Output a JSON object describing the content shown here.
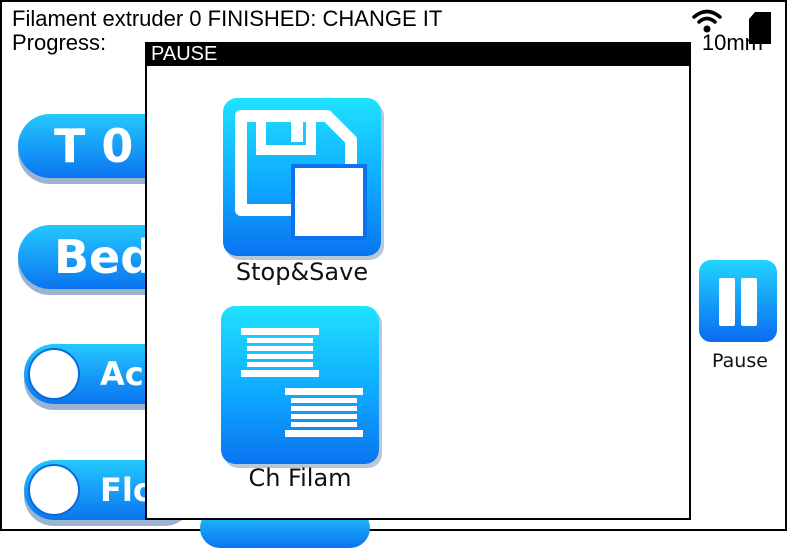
{
  "status": {
    "line1": "Filament extruder 0 FINISHED: CHANGE IT",
    "line2_label": "Progress:",
    "line2_right": "10mm",
    "wifi_icon": "wifi-icon",
    "sd_icon": "sd-card-icon"
  },
  "controls": {
    "temp_label": "T 0",
    "bed_label": "Bed",
    "active_label": "Ac",
    "flow_label": "Flo"
  },
  "pause": {
    "label": "Pause",
    "icon": "pause-icon"
  },
  "modal": {
    "title": "PAUSE",
    "items": [
      {
        "label": "Stop&Save",
        "icon": "save-floppy-icon"
      },
      {
        "label": "Ch Filam",
        "icon": "filament-spool-icon"
      }
    ]
  },
  "colors": {
    "accent_top": "#1fe2ff",
    "accent_bottom": "#0a74f0",
    "title_bar": "#000000"
  }
}
